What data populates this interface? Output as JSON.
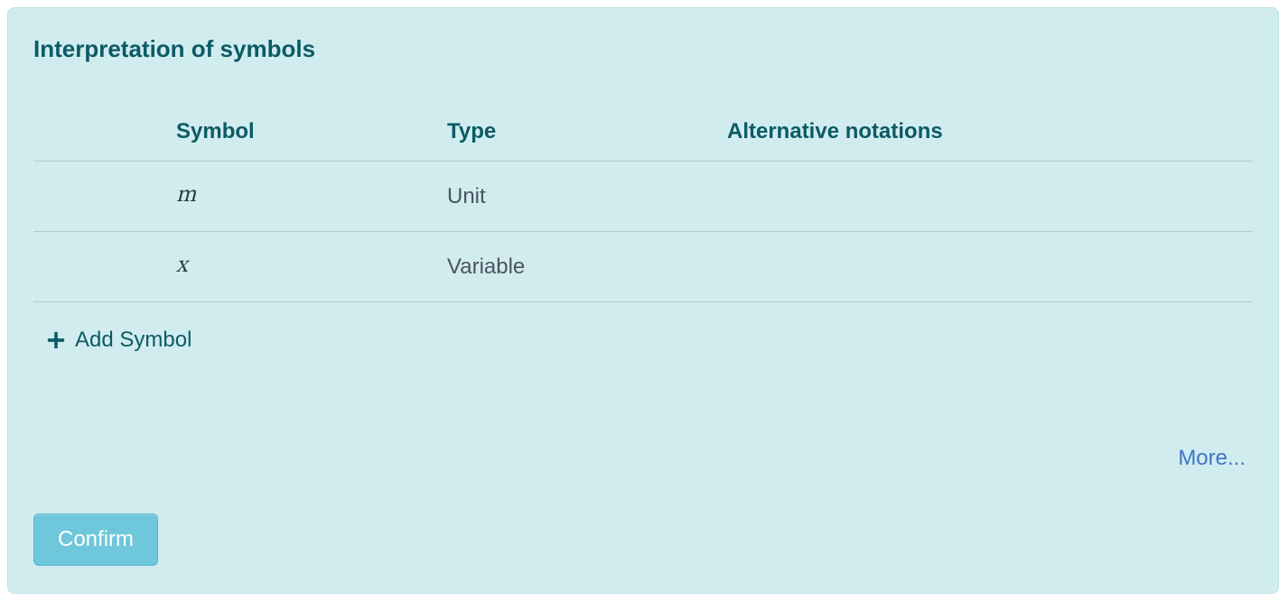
{
  "panel": {
    "title": "Interpretation of symbols",
    "columns": {
      "symbol": "Symbol",
      "type": "Type",
      "alternative": "Alternative notations"
    },
    "rows": [
      {
        "symbol": "m",
        "type": "Unit",
        "alternative": ""
      },
      {
        "symbol": "x",
        "type": "Variable",
        "alternative": ""
      }
    ],
    "add_label": "Add Symbol",
    "more_label": "More...",
    "confirm_label": "Confirm"
  }
}
